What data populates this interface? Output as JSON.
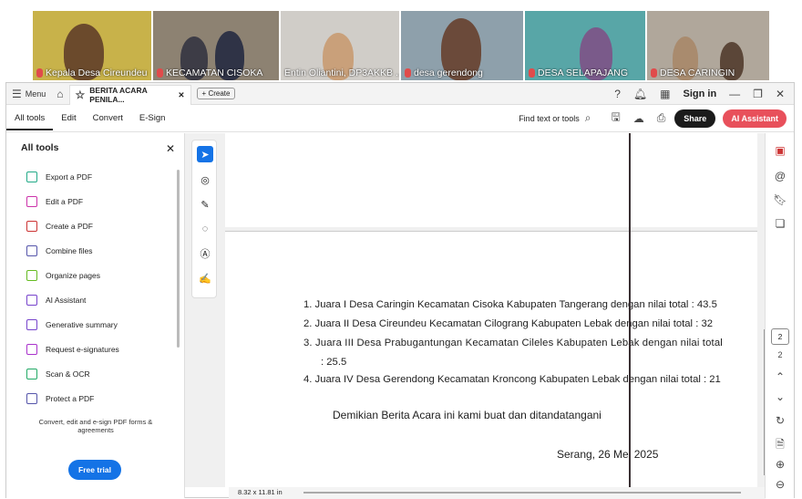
{
  "video_strip": {
    "tiles": [
      {
        "name": "Kepala Desa Cireundeu",
        "bg": "#c9b34a"
      },
      {
        "name": "KECAMATAN CISOKA",
        "bg": "#9a8f7e"
      },
      {
        "name": "Entin Oliantini, DP3AKKB ...",
        "bg": "#c8c6c2"
      },
      {
        "name": "desa gerendong",
        "bg": "#8ea0ab"
      },
      {
        "name": "DESA SELAPAJANG",
        "bg": "#5aa7a8"
      },
      {
        "name": "DESA CARINGIN",
        "bg": "#b0a79b"
      }
    ]
  },
  "tabbar": {
    "menu_label": "Menu",
    "tab_title": "BERITA ACARA PENILA...",
    "create_label": "Create",
    "sign_in": "Sign in"
  },
  "menubar": {
    "items": [
      "All tools",
      "Edit",
      "Convert",
      "E-Sign"
    ],
    "find_label": "Find text or tools",
    "share_label": "Share",
    "ai_label": "AI Assistant"
  },
  "sidepanel": {
    "title": "All tools",
    "tools": [
      "Export a PDF",
      "Edit a PDF",
      "Create a PDF",
      "Combine files",
      "Organize pages",
      "AI Assistant",
      "Generative summary",
      "Request e-signatures",
      "Scan & OCR",
      "Protect a PDF"
    ],
    "promo_text": "Convert, edit and e-sign PDF forms & agreements",
    "trial_label": "Free trial"
  },
  "document": {
    "lines": [
      "1.  Juara I Desa Caringin Kecamatan Cisoka Kabupaten  Tangerang dengan nilai total : 43.5",
      "2.  Juara II Desa Cireundeu Kecamatan Cilograng Kabupaten Lebak dengan nilai total : 32",
      "3.  Juara III Desa Prabugantungan Kecamatan Cileles Kabupaten Lebak dengan nilai total",
      ": 25.5",
      "4.  Juara IV Desa Gerendong Kecamatan Kroncong Kabupaten Lebak dengan nilai total : 21"
    ],
    "closing": "Demikian Berita Acara ini kami buat dan ditandatangani",
    "place_date": "Serang, 26 Mei 2025"
  },
  "status": {
    "page_size": "8.32 x 11.81 in"
  },
  "pagination": {
    "current": "2",
    "total": "2"
  }
}
